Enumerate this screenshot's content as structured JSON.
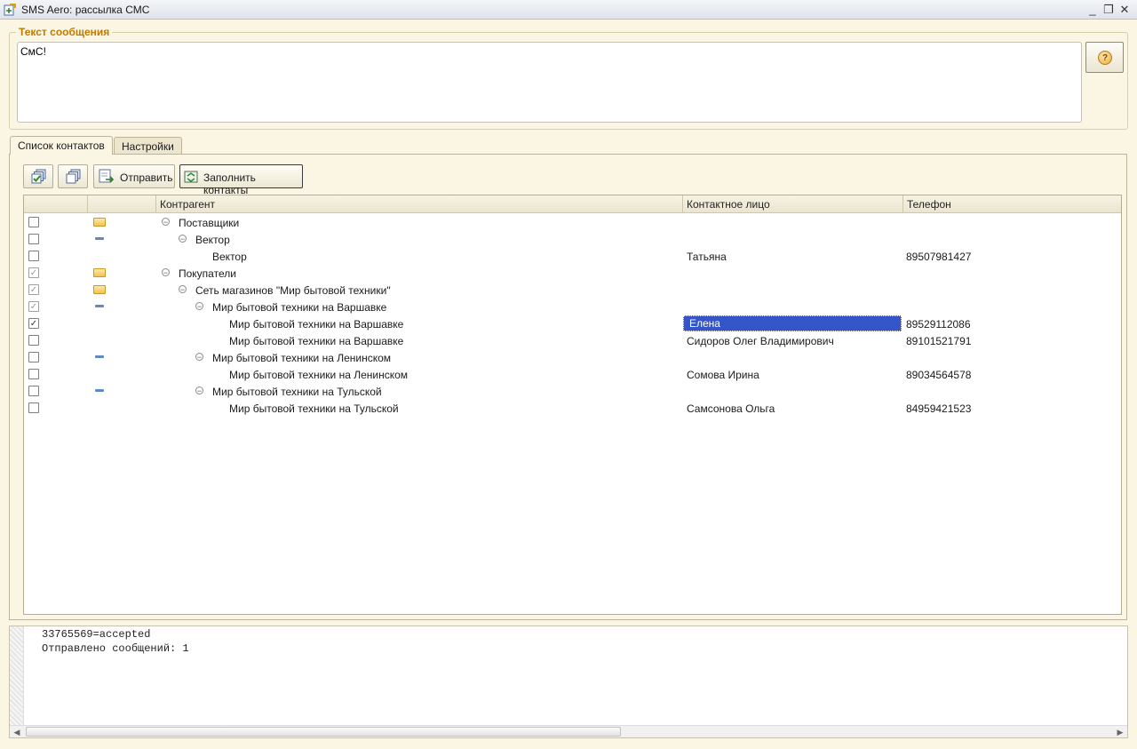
{
  "window": {
    "title": "SMS Aero: рассылка СМС"
  },
  "message": {
    "legend": "Текст сообщения",
    "text": "СмС!",
    "help_icon": "question-icon",
    "help_glyph": "?"
  },
  "tabs": [
    {
      "label": "Список контактов",
      "active": true
    },
    {
      "label": "Настройки",
      "active": false
    }
  ],
  "toolbar": {
    "send_label": "Отправить",
    "fill_label": "Заполнить контакты"
  },
  "table": {
    "columns": [
      "Контрагент",
      "Контактное лицо",
      "Телефон"
    ],
    "rows": [
      {
        "checked": false,
        "kind": "folder",
        "level": 0,
        "expanded": true,
        "name": "Поставщики",
        "contact": "",
        "phone": ""
      },
      {
        "checked": false,
        "kind": "item",
        "level": 1,
        "expanded": true,
        "name": "Вектор",
        "contact": "",
        "phone": ""
      },
      {
        "checked": false,
        "kind": "none",
        "level": 2,
        "expanded": false,
        "name": "Вектор",
        "contact": "Татьяна",
        "phone": "89507981427"
      },
      {
        "checked": true,
        "grey": true,
        "kind": "folder",
        "level": 0,
        "expanded": true,
        "name": "Покупатели",
        "contact": "",
        "phone": ""
      },
      {
        "checked": true,
        "grey": true,
        "kind": "folder",
        "level": 1,
        "expanded": true,
        "name": "Сеть магазинов \"Мир бытовой техники\"",
        "contact": "",
        "phone": ""
      },
      {
        "checked": true,
        "grey": true,
        "kind": "item",
        "level": 2,
        "expanded": true,
        "name": "Мир бытовой техники на Варшавке",
        "contact": "",
        "phone": ""
      },
      {
        "checked": true,
        "kind": "none",
        "level": 3,
        "expanded": false,
        "name": "Мир бытовой техники на Варшавке",
        "contact": "Елена",
        "phone": "89529112086",
        "selected": true
      },
      {
        "checked": false,
        "kind": "none",
        "level": 3,
        "expanded": false,
        "name": "Мир бытовой техники на Варшавке",
        "contact": "Сидоров Олег Владимирович",
        "phone": "89101521791"
      },
      {
        "checked": false,
        "kind": "item",
        "level": 2,
        "expanded": true,
        "name": "Мир бытовой техники на Ленинском",
        "contact": "",
        "phone": ""
      },
      {
        "checked": false,
        "kind": "none",
        "level": 3,
        "expanded": false,
        "name": "Мир бытовой техники на Ленинском",
        "contact": "Сомова Ирина",
        "phone": "89034564578"
      },
      {
        "checked": false,
        "kind": "item",
        "level": 2,
        "expanded": true,
        "name": "Мир бытовой техники на Тульской",
        "contact": "",
        "phone": ""
      },
      {
        "checked": false,
        "kind": "none",
        "level": 3,
        "expanded": false,
        "name": "Мир бытовой техники на Тульской",
        "contact": "Самсонова Ольга",
        "phone": "84959421523"
      }
    ]
  },
  "log": {
    "lines": [
      "33765569=accepted",
      "Отправлено сообщений: 1"
    ]
  },
  "colors": {
    "accent": "#c07a00",
    "selection": "#3556c8",
    "background": "#fbf6e4"
  }
}
